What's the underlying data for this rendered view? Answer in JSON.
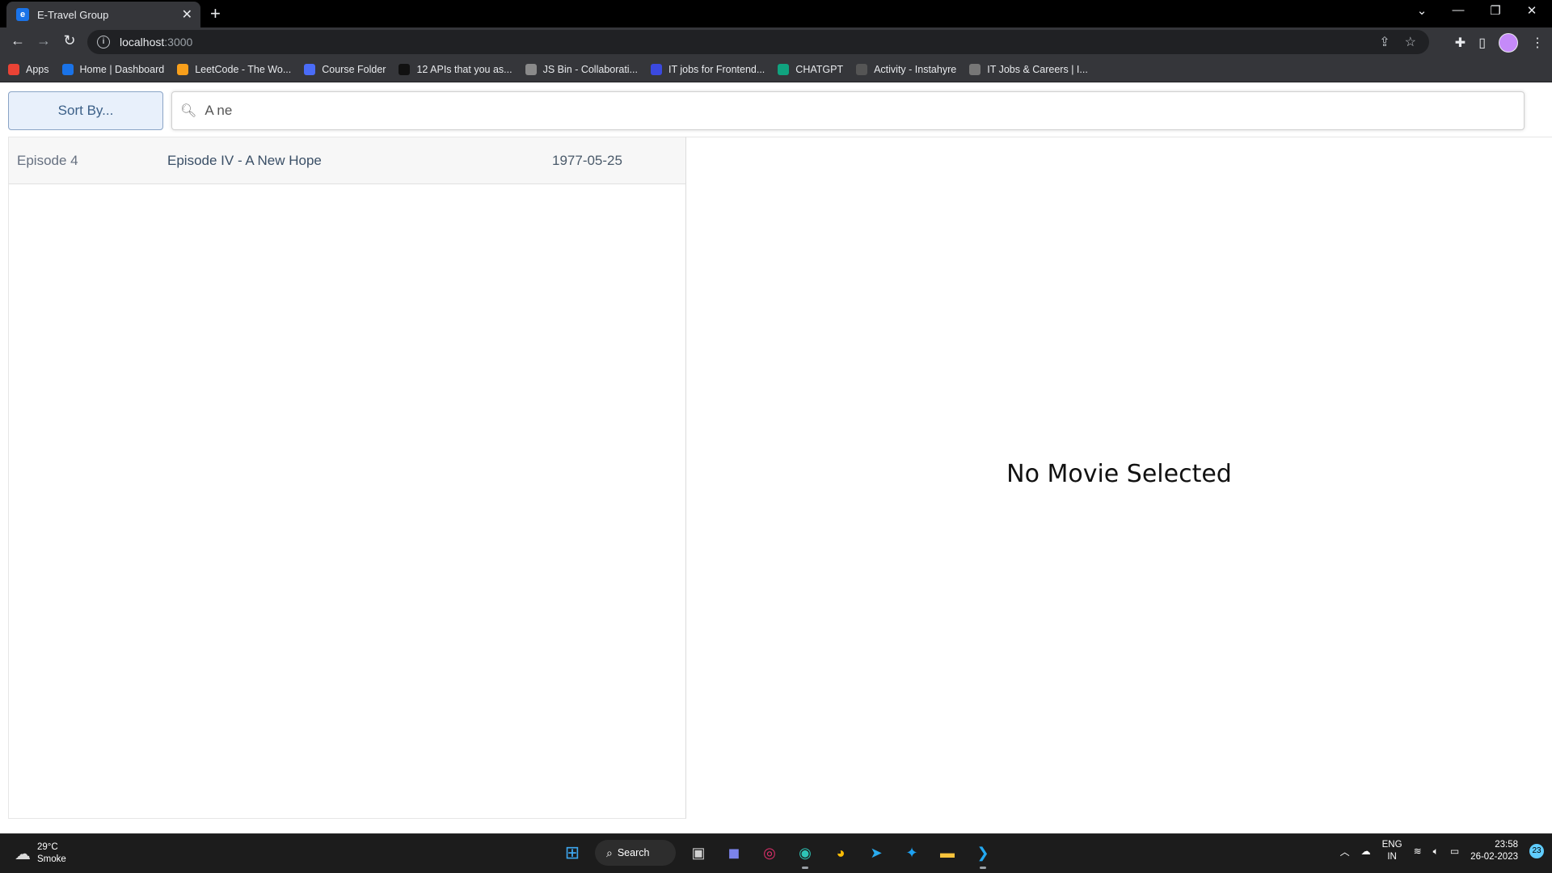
{
  "browser": {
    "tab_title": "E-Travel Group",
    "url_host": "localhost",
    "url_port": ":3000",
    "bookmarks": [
      {
        "label": "Apps",
        "icon": "apps-grid-icon",
        "color": "#ea4335"
      },
      {
        "label": "Home | Dashboard",
        "icon": "k-icon",
        "color": "#1a73e8"
      },
      {
        "label": "LeetCode - The Wo...",
        "icon": "leetcode-icon",
        "color": "#f89f1b"
      },
      {
        "label": "Course Folder",
        "icon": "course-icon",
        "color": "#4a6cf7"
      },
      {
        "label": "12 APIs that you as...",
        "icon": "dev-icon",
        "color": "#111111"
      },
      {
        "label": "JS Bin - Collaborati...",
        "icon": "jsbin-icon",
        "color": "#8a8a8a"
      },
      {
        "label": "IT jobs for Frontend...",
        "icon": "dev-blue-icon",
        "color": "#3b49df"
      },
      {
        "label": "CHATGPT",
        "icon": "chatgpt-icon",
        "color": "#10a37f"
      },
      {
        "label": "Activity - Instahyre",
        "icon": "instahyre-icon",
        "color": "#555555"
      },
      {
        "label": "IT Jobs & Careers | I...",
        "icon": "itjobs-icon",
        "color": "#777777"
      }
    ]
  },
  "toolbar": {
    "sort_label": "Sort By...",
    "search_value": "A ne"
  },
  "movies": [
    {
      "episode": "Episode 4",
      "title": "Episode IV - A New Hope",
      "release_date": "1977-05-25"
    }
  ],
  "detail": {
    "empty_message": "No Movie Selected"
  },
  "taskbar": {
    "temperature": "29°C",
    "weather": "Smoke",
    "search_label": "Search",
    "lang_line1": "ENG",
    "lang_line2": "IN",
    "time": "23:58",
    "date": "26-02-2023",
    "notifications": "23"
  }
}
